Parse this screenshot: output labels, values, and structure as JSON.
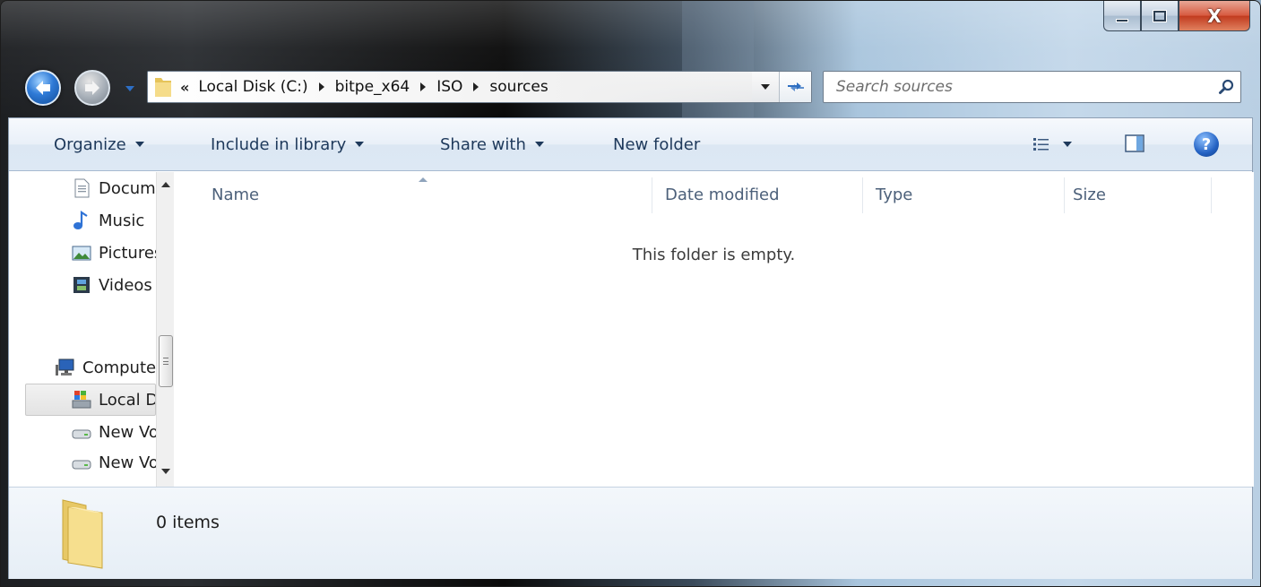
{
  "window": {
    "caption": {
      "minimize": "minimize",
      "maximize": "maximize",
      "close": "close"
    }
  },
  "address": {
    "overflow_chevron": "«",
    "crumbs": [
      "Local Disk (C:)",
      "bitpe_x64",
      "ISO",
      "sources"
    ]
  },
  "search": {
    "placeholder": "Search sources"
  },
  "toolbar": {
    "organize": "Organize",
    "include_in_library": "Include in library",
    "share_with": "Share with",
    "new_folder": "New folder",
    "help": "?"
  },
  "navpane": {
    "items": [
      {
        "label": "Documents",
        "icon": "document-icon"
      },
      {
        "label": "Music",
        "icon": "music-note-icon"
      },
      {
        "label": "Pictures",
        "icon": "pictures-icon"
      },
      {
        "label": "Videos",
        "icon": "film-icon"
      },
      {
        "label": "Computer",
        "icon": "computer-icon"
      },
      {
        "label": "Local Disk (C:)",
        "icon": "windows-drive-icon",
        "selected": true
      },
      {
        "label": "New Volume",
        "icon": "drive-icon"
      },
      {
        "label": "New Volume",
        "icon": "drive-icon"
      }
    ]
  },
  "columns": [
    "Name",
    "Date modified",
    "Type",
    "Size"
  ],
  "content": {
    "empty_message": "This folder is empty."
  },
  "details": {
    "item_count": "0 items"
  },
  "colors": {
    "toolbar_text": "#1e395b",
    "header_text": "#4c607a",
    "close_red": "#c13a1e"
  }
}
